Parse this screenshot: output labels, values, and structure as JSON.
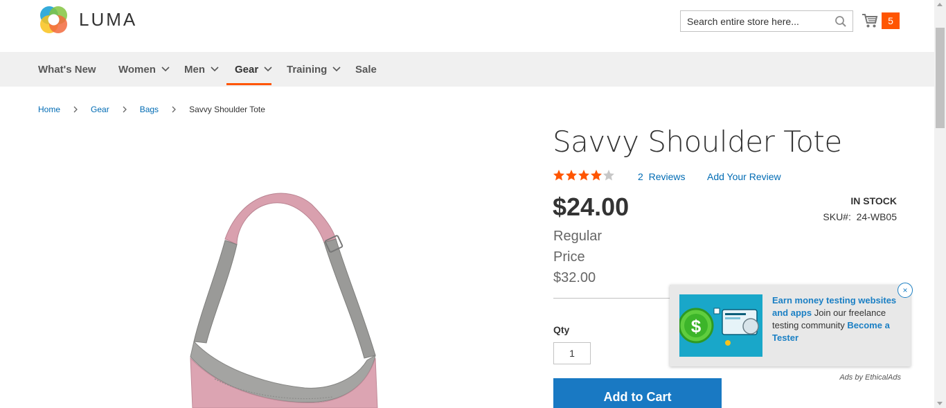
{
  "header": {
    "logo_text": "LUMA",
    "search_placeholder": "Search entire store here...",
    "cart_count": "5"
  },
  "nav": {
    "items": [
      {
        "label": "What's New",
        "has_dropdown": false
      },
      {
        "label": "Women",
        "has_dropdown": true
      },
      {
        "label": "Men",
        "has_dropdown": true
      },
      {
        "label": "Gear",
        "has_dropdown": true,
        "active": true
      },
      {
        "label": "Training",
        "has_dropdown": true
      },
      {
        "label": "Sale",
        "has_dropdown": false
      }
    ]
  },
  "breadcrumb": {
    "items": [
      "Home",
      "Gear",
      "Bags"
    ],
    "current": "Savvy Shoulder Tote"
  },
  "product": {
    "title": "Savvy Shoulder Tote",
    "rating_stars": 4,
    "rating_max": 5,
    "reviews_count": "2",
    "reviews_label": "Reviews",
    "add_review_label": "Add Your Review",
    "price": "$24.00",
    "regular_price_label": "Regular Price",
    "regular_price": "$32.00",
    "stock_status": "IN STOCK",
    "sku_label": "SKU#:",
    "sku_value": "24-WB05",
    "qty_label": "Qty",
    "qty_value": "1",
    "add_to_cart_label": "Add to Cart"
  },
  "ad": {
    "headline": "Earn money testing websites and apps",
    "body": "Join our freelance testing community",
    "cta": "Become a Tester",
    "close_label": "×",
    "attribution": "Ads by EthicalAds"
  },
  "colors": {
    "accent": "#ff5501",
    "link": "#006bb4",
    "button": "#1979c3",
    "nav_bg": "#f0f0f0",
    "star_filled": "#ff5501",
    "star_empty": "#c7c7c7"
  }
}
